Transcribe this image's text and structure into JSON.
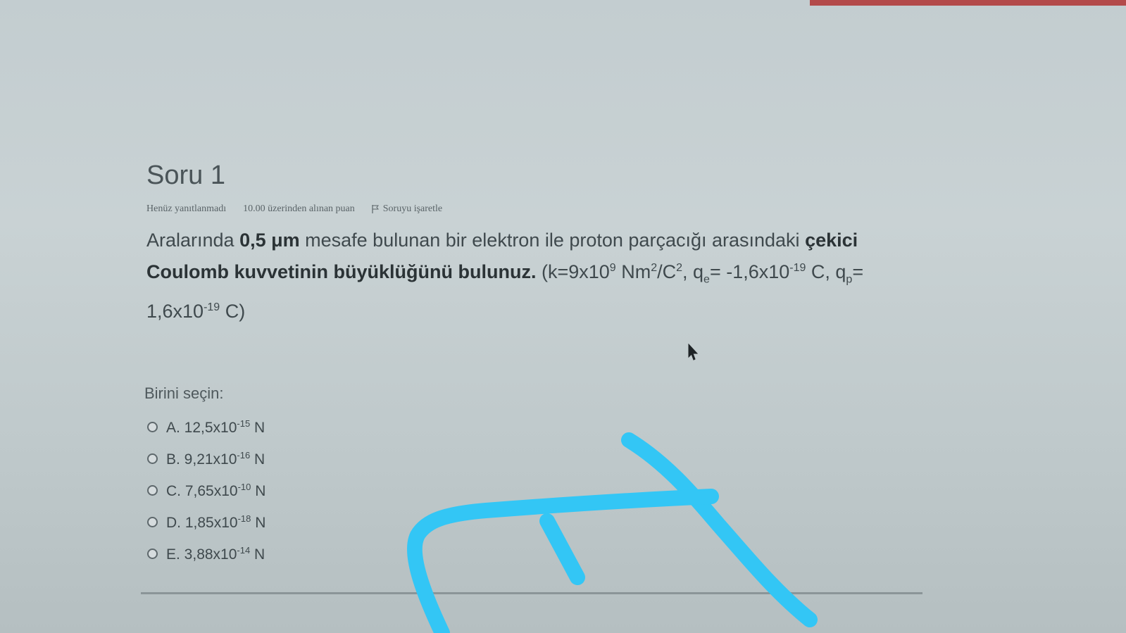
{
  "question": {
    "title": "Soru 1",
    "status": "Henüz yanıtlanmadı",
    "points": "10.00 üzerinden alınan puan",
    "flag_label": "Soruyu işaretle",
    "text": {
      "p1": "Aralarında ",
      "distance": "0,5 μm",
      "p2": " mesafe bulunan bir elektron ile proton parçacığı arasındaki ",
      "bold": "çekici Coulomb kuvvetinin büyüklüğünü bulunuz.",
      "k_a": " (k=9x10",
      "k_exp": "9",
      "k_b": " Nm",
      "nm_exp": "2",
      "k_c": "/C",
      "c_exp": "2",
      "qe_a": ", q",
      "qe_sub": "e",
      "qe_b": "= -1,6x10",
      "qe_exp": "-19",
      "qp_a": " C, q",
      "qp_sub": "p",
      "qp_b": "= 1,6x10",
      "qp_exp": "-19",
      "end": " C)"
    }
  },
  "answers": {
    "prompt": "Birini seçin:",
    "options": [
      {
        "label": "A. 12,5x10",
        "exp": "-15",
        "unit": " N"
      },
      {
        "label": "B. 9,21x10",
        "exp": "-16",
        "unit": " N"
      },
      {
        "label": "C. 7,65x10",
        "exp": "-10",
        "unit": " N"
      },
      {
        "label": "D. 1,85x10",
        "exp": "-18",
        "unit": " N"
      },
      {
        "label": "E. 3,88x10",
        "exp": "-14",
        "unit": " N"
      }
    ]
  },
  "colors": {
    "pen_annotation": "#33c6f5",
    "top_strip": "#b34a4a"
  }
}
